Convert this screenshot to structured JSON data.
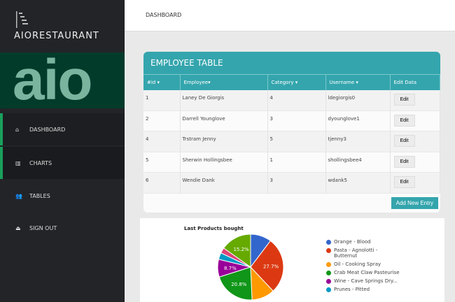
{
  "brand": "AIORESTAURANT",
  "logo_text": "aio",
  "nav": [
    {
      "label": "DASHBOARD",
      "icon": "home-icon"
    },
    {
      "label": "CHARTS",
      "icon": "bar-chart-icon"
    },
    {
      "label": "TABLES",
      "icon": "users-icon"
    },
    {
      "label": "SIGN OUT",
      "icon": "eject-icon"
    }
  ],
  "header": {
    "breadcrumb": "DASHBOARD"
  },
  "table": {
    "title": "EMPLOYEE TABLE",
    "columns": [
      "#id",
      "Employee",
      "Category",
      "Username",
      "Edit Data"
    ],
    "rows": [
      [
        "1",
        "Laney De Giorgis",
        "4",
        "ldegiorgis0"
      ],
      [
        "2",
        "Darrell Younglove",
        "3",
        "dyounglove1"
      ],
      [
        "4",
        "Trstram Jenny",
        "5",
        "tjenny3"
      ],
      [
        "5",
        "Sherwin Hollingsbee",
        "1",
        "shollingsbee4"
      ],
      [
        "6",
        "Wendie Dank",
        "3",
        "wdank5"
      ]
    ],
    "edit_label": "Edit",
    "add_label": "Add New Entry"
  },
  "chart_data": {
    "type": "pie",
    "title": "Last Products bought",
    "categories": [
      "Orange - Blood",
      "Pasta - Agnolotti - Butternut",
      "Oil - Cooking Spray",
      "Crab Meat Claw Pasteurise",
      "Wine - Cave Springs Dry...",
      "Prunes - Pitted",
      "(hidden)",
      "(hidden)"
    ],
    "values": [
      10.3,
      27.7,
      11.3,
      20.8,
      8.7,
      3.3,
      2.7,
      15.2
    ],
    "labels": [
      "",
      "27.7%",
      "",
      "20.8%",
      "8.7%",
      "",
      "",
      "15.2%"
    ],
    "colors": [
      "#3366cc",
      "#dc3912",
      "#ff9900",
      "#109618",
      "#990099",
      "#0099c6",
      "#dd4477",
      "#66aa00"
    ],
    "legend_visible": 6
  }
}
